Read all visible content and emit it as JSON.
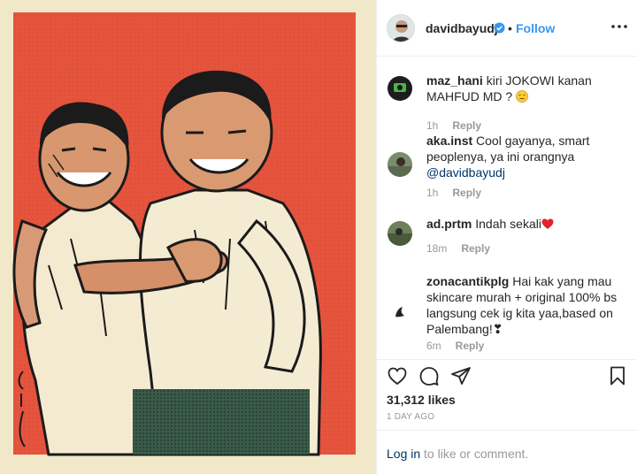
{
  "post": {
    "username": "davidbayudj",
    "follow_label": "Follow",
    "separator": "•",
    "likes": "31,312 likes",
    "date": "1 DAY AGO"
  },
  "comments": [
    {
      "user": "maz_hani",
      "text": "kiri JOKOWI kanan MAHFUD MD ?",
      "emoji": "expressionless-face",
      "time": "1h",
      "reply": "Reply"
    },
    {
      "user": "aka.inst",
      "text": "Cool gayanya, smart peoplenya, ya ini orangnya",
      "mention": "@davidbayudj",
      "time": "1h",
      "reply": "Reply"
    },
    {
      "user": "ad.prtm",
      "text": "Indah sekali",
      "emoji": "red-heart",
      "time": "18m",
      "reply": "Reply"
    },
    {
      "user": "zonacantikplg",
      "text": "Hai kak yang mau skincare murah + original 100% bs langsung cek ig kita yaa,based on Palembang!❣",
      "time": "6m",
      "reply": "Reply"
    }
  ],
  "login": {
    "link": "Log in",
    "rest": "to like or comment."
  },
  "icons": {
    "like": "heart-outline-icon",
    "comment": "comment-bubble-icon",
    "share": "paper-plane-icon",
    "save": "bookmark-icon",
    "more": "more-dots-icon",
    "verified": "verified-badge-icon"
  },
  "colors": {
    "accent": "#3897f0",
    "link": "#003569",
    "muted": "#999999",
    "artwork_bg": "#e8553f"
  }
}
